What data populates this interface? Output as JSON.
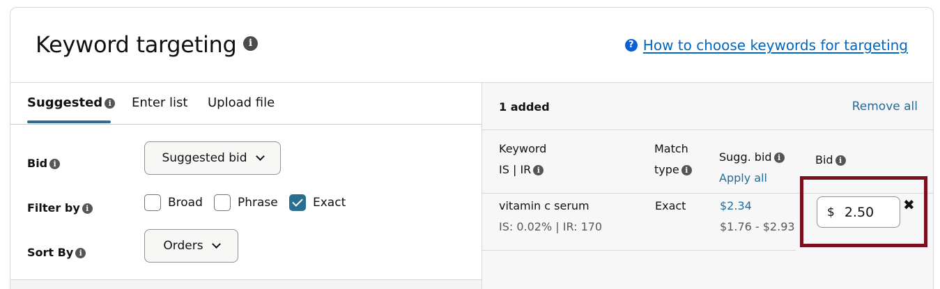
{
  "header": {
    "title": "Keyword targeting",
    "help_link": "How to choose keywords for targeting"
  },
  "tabs": [
    {
      "label": "Suggested",
      "active": true
    },
    {
      "label": "Enter list",
      "active": false
    },
    {
      "label": "Upload file",
      "active": false
    }
  ],
  "filters": {
    "bid_label": "Bid",
    "bid_dropdown": "Suggested bid",
    "filter_label": "Filter by",
    "options": [
      {
        "label": "Broad",
        "checked": false
      },
      {
        "label": "Phrase",
        "checked": false
      },
      {
        "label": "Exact",
        "checked": true
      }
    ],
    "sort_label": "Sort By",
    "sort_dropdown": "Orders"
  },
  "added_panel": {
    "count_text": "1 added",
    "remove_all": "Remove all",
    "columns": {
      "keyword": "Keyword",
      "keyword_sub": "IS | IR",
      "match_1": "Match",
      "match_2": "type",
      "sugg_bid": "Sugg. bid",
      "apply_all": "Apply all",
      "bid": "Bid"
    },
    "rows": [
      {
        "keyword": "vitamin c serum",
        "stats": "IS: 0.02% | IR: 170",
        "match_type": "Exact",
        "sugg_bid": "$2.34",
        "sugg_range": "$1.76 - $2.93",
        "currency": "$",
        "bid_value": "2.50",
        "remove": "✖"
      }
    ]
  },
  "colors": {
    "accent": "#2a6f8f",
    "link": "#1f6b9c",
    "highlight": "#7a0f1f"
  }
}
